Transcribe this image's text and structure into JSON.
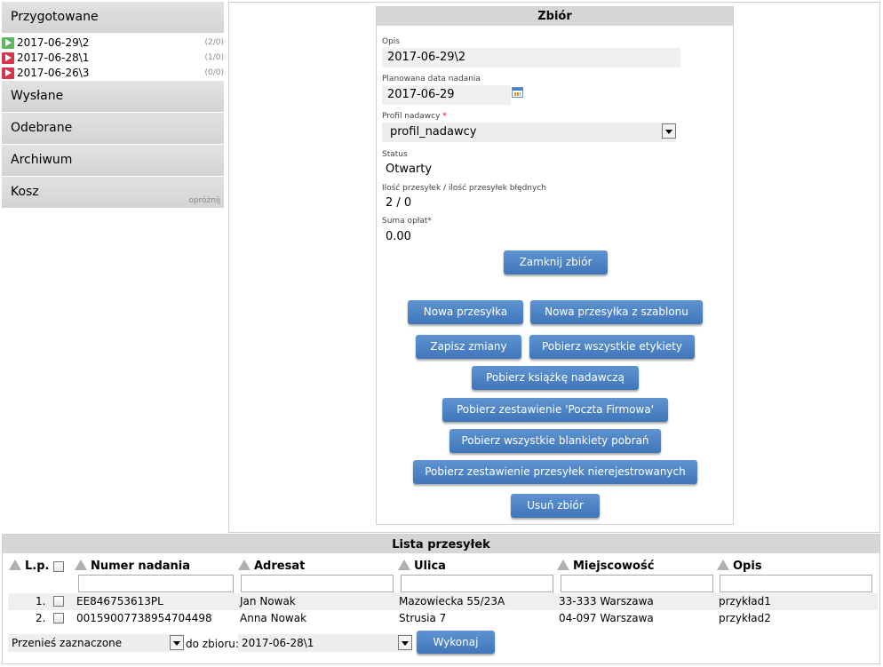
{
  "sidebar": {
    "prepared": {
      "label": "Przygotowane",
      "items": [
        {
          "label": "2017-06-29\\2",
          "count": "(2/0)",
          "color": "#5cb85c"
        },
        {
          "label": "2017-06-28\\1",
          "count": "(1/0)",
          "color": "#d9344f"
        },
        {
          "label": "2017-06-26\\3",
          "count": "(0/0)",
          "color": "#d9344f"
        }
      ]
    },
    "sent": {
      "label": "Wysłane"
    },
    "received": {
      "label": "Odebrane"
    },
    "archive": {
      "label": "Archiwum"
    },
    "trash": {
      "label": "Kosz",
      "empty_link": "opróżnij"
    }
  },
  "form": {
    "title": "Zbiór",
    "desc_label": "Opis",
    "desc_value": "2017-06-29\\2",
    "date_label": "Planowana data nadania",
    "date_value": "2017-06-29",
    "profile_label": "Profil nadawcy",
    "profile_required": "*",
    "profile_value": "profil_nadawcy",
    "status_label": "Status",
    "status_value": "Otwarty",
    "count_label": "Ilość przesyłek / ilość przesyłek błędnych",
    "count_value": "2 / 0",
    "fees_label": "Suma opłat*",
    "fees_value": "0.00",
    "buttons": {
      "close": "Zamknij zbiór",
      "new_shipment": "Nowa przesyłka",
      "new_from_template": "Nowa przesyłka z szablonu",
      "save": "Zapisz zmiany",
      "get_labels": "Pobierz wszystkie etykiety",
      "get_book": "Pobierz książkę nadawczą",
      "get_firmowa": "Pobierz zestawienie 'Poczta Firmowa'",
      "get_blanks": "Pobierz wszystkie blankiety pobrań",
      "get_unregistered": "Pobierz zestawienie przesyłek nierejestrowanych",
      "delete": "Usuń zbiór"
    }
  },
  "list": {
    "title": "Lista przesyłek",
    "columns": {
      "lp": "L.p.",
      "number": "Numer nadania",
      "addressee": "Adresat",
      "street": "Ulica",
      "city": "Miejscowość",
      "desc": "Opis"
    },
    "rows": [
      {
        "lp": "1.",
        "number": "EE846753613PL",
        "addressee": "Jan Nowak",
        "street": "Mazowiecka 55/23A",
        "city": "33-333 Warszawa",
        "desc": "przykład1"
      },
      {
        "lp": "2.",
        "number": "00159007738954704498",
        "addressee": "Anna Nowak",
        "street": "Strusia 7",
        "city": "04-097 Warszawa",
        "desc": "przykład2"
      }
    ],
    "action_select": "Przenieś zaznaczone",
    "to_set_label": "do zbioru:",
    "target_select": "2017-06-28\\1",
    "execute": "Wykonaj"
  }
}
